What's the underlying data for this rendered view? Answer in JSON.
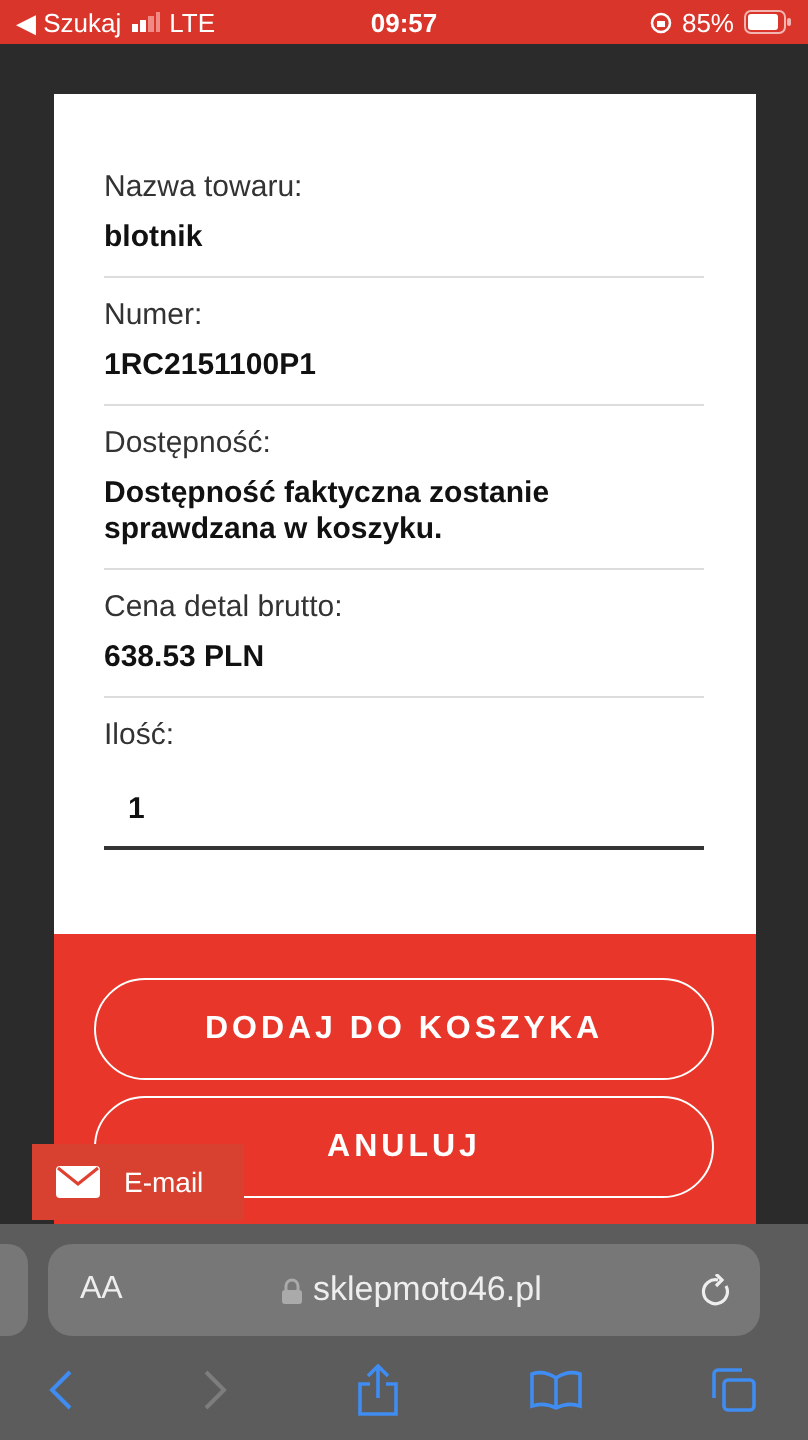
{
  "status_bar": {
    "back_label": "◀ Szukaj",
    "network": "LTE",
    "time": "09:57",
    "battery": "85%"
  },
  "modal": {
    "fields": [
      {
        "kind": "info",
        "label": "Nazwa towaru:",
        "value": "blotnik"
      },
      {
        "kind": "info",
        "label": "Numer:",
        "value": "1RC2151100P1"
      },
      {
        "kind": "info",
        "label": "Dostępność:",
        "value": "Dostępność faktyczna zostanie sprawdzana w koszyku."
      },
      {
        "kind": "info",
        "label": "Cena detal brutto:",
        "value": "638.53 PLN"
      },
      {
        "kind": "input",
        "label": "Ilość:",
        "value": "1"
      }
    ],
    "buttons": [
      "DODAJ DO KOSZYKA",
      "ANULUJ"
    ]
  },
  "email_tab": {
    "label": "E-mail"
  },
  "browser": {
    "text_size": "AA",
    "url": "sklepmoto46.pl",
    "toolbar": [
      {
        "kind": "back",
        "disabled": false
      },
      {
        "kind": "forward",
        "disabled": true
      },
      {
        "kind": "share",
        "disabled": false
      },
      {
        "kind": "bookmarks",
        "disabled": false
      },
      {
        "kind": "tabs",
        "disabled": false
      }
    ]
  }
}
